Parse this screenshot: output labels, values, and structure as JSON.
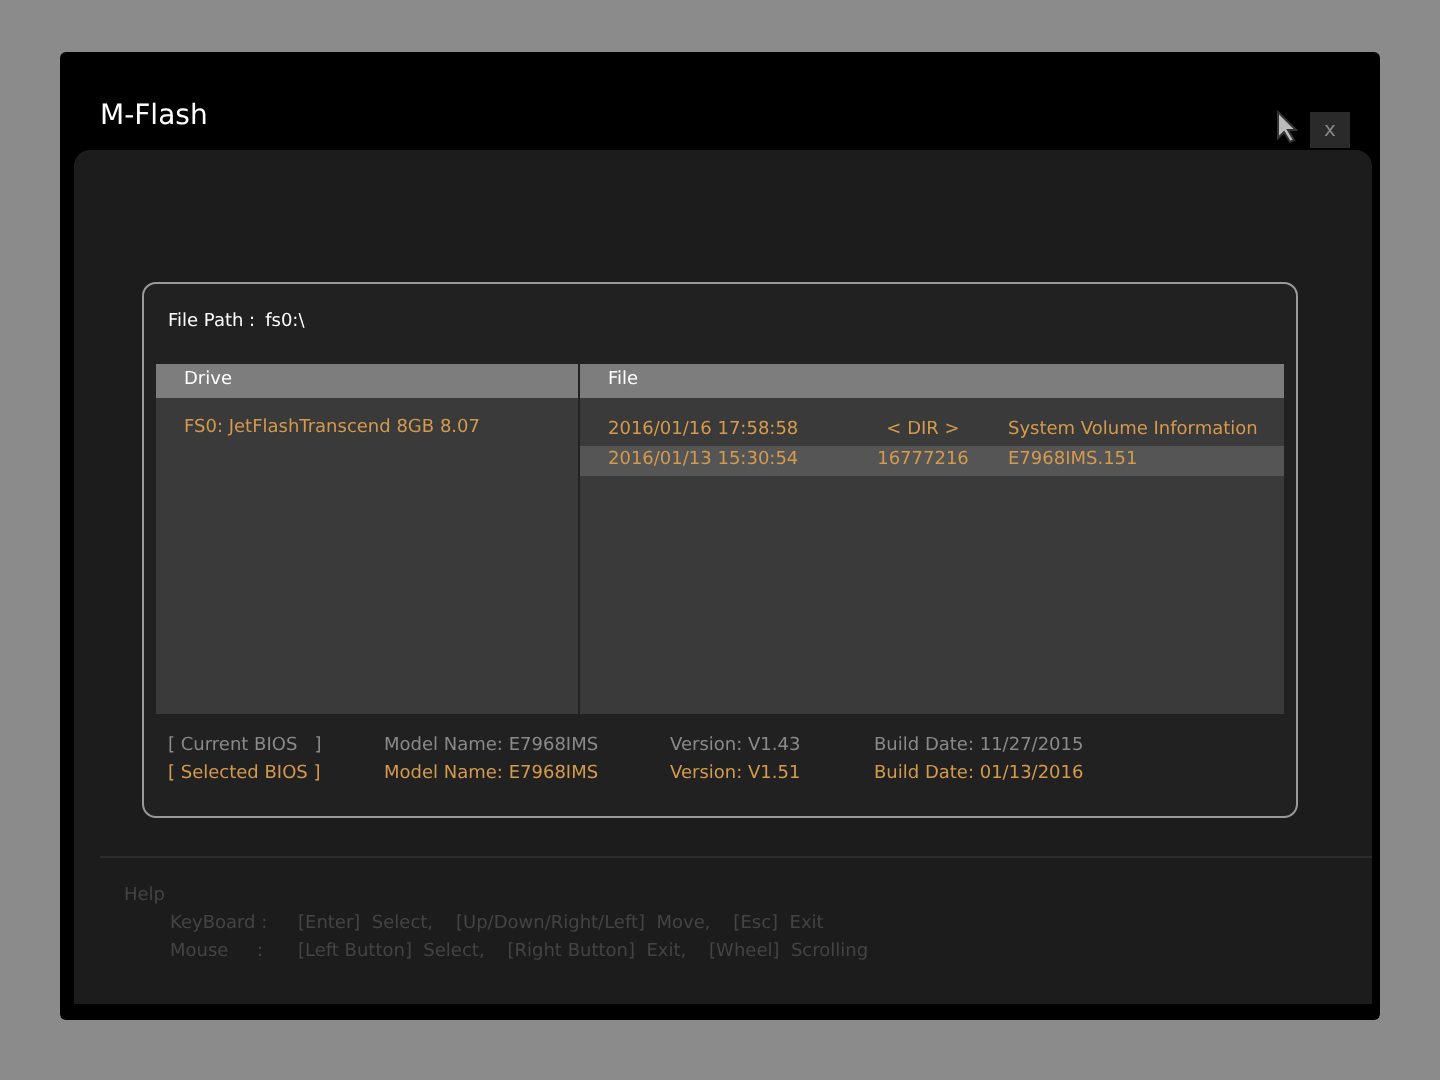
{
  "window": {
    "title": "M-Flash",
    "close": "x"
  },
  "file_path": {
    "label": "File Path :",
    "value": "fs0:\\"
  },
  "drive_column": {
    "heading": "Drive",
    "items": [
      {
        "label": "FS0: JetFlashTranscend 8GB 8.07",
        "selected": false
      }
    ]
  },
  "file_column": {
    "heading": "File",
    "rows": [
      {
        "date": "2016/01/16 17:58:58",
        "size": "< DIR >",
        "name": "System Volume Information",
        "selected": false
      },
      {
        "date": "2016/01/13 15:30:54",
        "size": "16777216",
        "name": "E7968IMS.151",
        "selected": true
      }
    ]
  },
  "bios": [
    {
      "kind": "current",
      "label": "[ Current BIOS   ]",
      "model": "Model Name: E7968IMS",
      "version": "Version: V1.43",
      "build": "Build Date: 11/27/2015"
    },
    {
      "kind": "selected",
      "label": "[ Selected BIOS ]",
      "model": "Model Name: E7968IMS",
      "version": "Version: V1.51",
      "build": "Build Date: 01/13/2016"
    }
  ],
  "help": {
    "title": "Help",
    "lines": [
      {
        "device": "KeyBoard :",
        "text": "[Enter]  Select,    [Up/Down/Right/Left]  Move,    [Esc]  Exit"
      },
      {
        "device": "Mouse     :",
        "text": "[Left Button]  Select,    [Right Button]  Exit,    [Wheel]  Scrolling"
      }
    ]
  }
}
